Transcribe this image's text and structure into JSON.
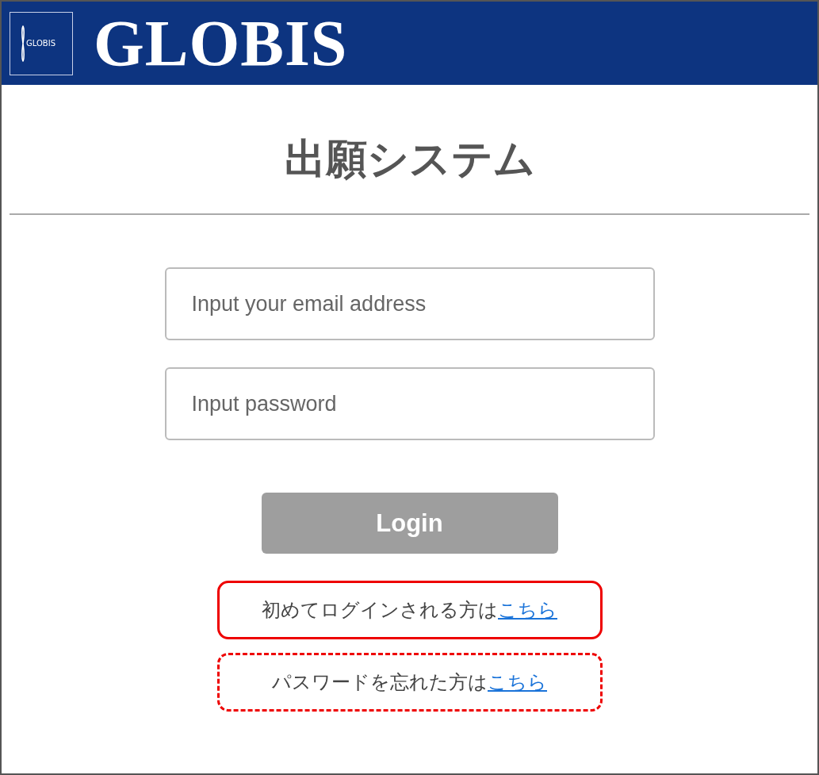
{
  "header": {
    "emblem_text": "GLOBIS",
    "brand": "GLOBIS"
  },
  "title": "出願システム",
  "fields": [
    {
      "placeholder": "Input your email address"
    },
    {
      "placeholder": "Input password"
    }
  ],
  "login_button": "Login",
  "links": [
    {
      "kind": "solid",
      "text": "初めてログインされる方は",
      "link": "こちら"
    },
    {
      "kind": "dashed",
      "text": "パスワードを忘れた方は",
      "link": "こちら"
    }
  ]
}
